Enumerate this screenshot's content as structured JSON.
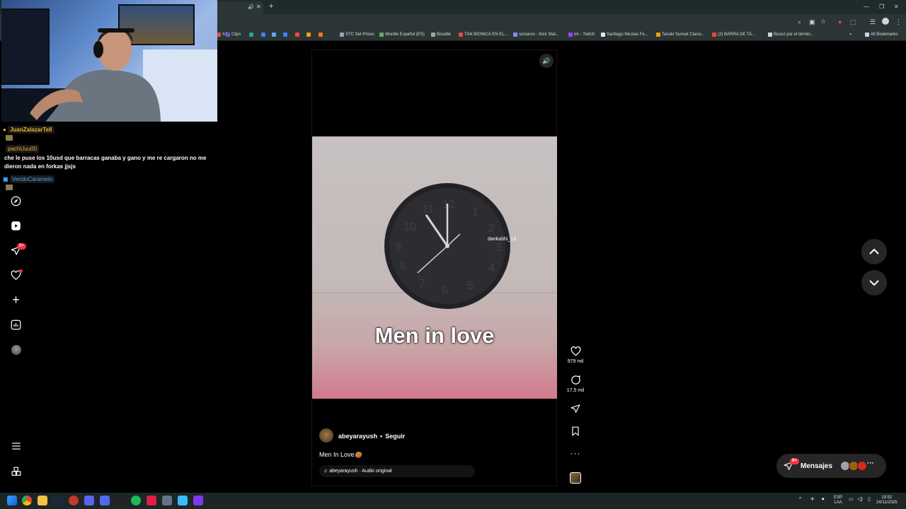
{
  "browser": {
    "bookmarks": [
      {
        "label": "AS",
        "color": "#e34c4c"
      },
      {
        "label": "Clips",
        "color": "#6a5acd"
      },
      {
        "label": "",
        "color": "#2aa198"
      },
      {
        "label": "",
        "color": "#3b82f6"
      },
      {
        "label": "",
        "color": "#60a5fa"
      },
      {
        "label": "",
        "color": "#3b82f6"
      },
      {
        "label": "",
        "color": "#ef4444"
      },
      {
        "label": "",
        "color": "#f59e0b"
      },
      {
        "label": "",
        "color": "#f97316"
      },
      {
        "label": "STC Set Prices",
        "color": "#9ca3af"
      },
      {
        "label": "Wordle Español (ES)",
        "color": "#6aaa64"
      },
      {
        "label": "Boiudle",
        "color": "#a3a3a3"
      },
      {
        "label": "TAN BIONICA EN EL...",
        "color": "#ef4444"
      },
      {
        "label": "sionaron - Kick Stat...",
        "color": "#818cf8"
      },
      {
        "label": "tnr - Twitch",
        "color": "#9146ff"
      },
      {
        "label": "Santiago Nicolas Fe...",
        "color": "#e5e7eb"
      },
      {
        "label": "Tanuki Sunset Classi...",
        "color": "#f59e0b"
      },
      {
        "label": "(2) BARRA DE TA...",
        "color": "#ef4444"
      },
      {
        "label": "Buscó por el términ...",
        "color": "#d1d5db"
      }
    ],
    "all_bookmarks": "All Bookmarks"
  },
  "chat": {
    "user1": "JuanZalazarTell",
    "user2": "pachUuu00",
    "message2": "che le puse los 10usd que barracas ganaba y gano y me re cargaron no me dieron nada en forkas jjsjs",
    "user3": "VendoCaramelo"
  },
  "nav": {
    "messages_badge": "9+"
  },
  "reel": {
    "overlay_caption": "Men in love",
    "tagged_user": "dankabhi_13",
    "author": "abeyarayush",
    "separator": "•",
    "follow_label": "Seguir",
    "caption": "Men In Love",
    "caption_emoji": "🥵",
    "audio": "abeyarayush · Audio original",
    "likes": "979 mil",
    "comments": "17,5 mil"
  },
  "messages_widget": {
    "label": "Mensajes",
    "badge": "9+"
  },
  "taskbar": {
    "lang1": "ESP",
    "lang2": "LAA",
    "time": "19:52",
    "date": "24/11/2025"
  },
  "colors": {
    "instagram_bg": "#000000",
    "badge_red": "#ff3040",
    "chrome_bg": "#2b3535"
  }
}
